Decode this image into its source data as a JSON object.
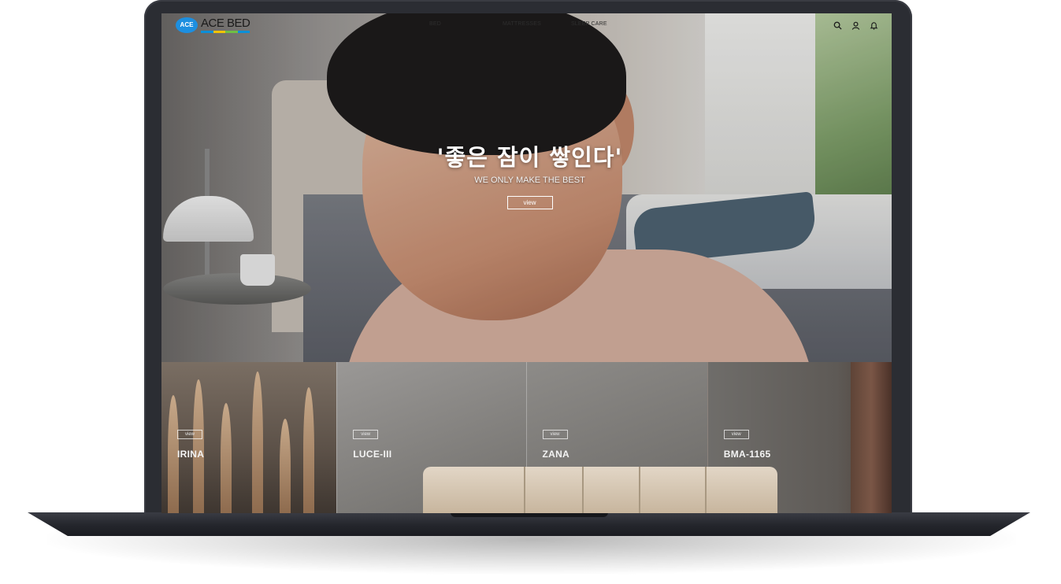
{
  "brand": {
    "badge": "ACE",
    "name": "ACE BED",
    "stripe_colors": [
      "#0b8fd8",
      "#f2c300",
      "#6fbe44",
      "#0b8fd8"
    ]
  },
  "nav": {
    "items": [
      "BED",
      "MATTRESSES",
      "SLEEP CARE"
    ]
  },
  "header_icons": [
    "search-icon",
    "user-icon",
    "bell-icon"
  ],
  "hero": {
    "title": "'좋은 잠이 쌓인다'",
    "subtitle": "WE ONLY MAKE THE BEST",
    "button_label": "view"
  },
  "products": [
    {
      "name": "IRINA",
      "button_label": "view"
    },
    {
      "name": "LUCE-III",
      "button_label": "view"
    },
    {
      "name": "ZANA",
      "button_label": "view"
    },
    {
      "name": "BMA-1165",
      "button_label": "view"
    }
  ],
  "colors": {
    "laptop_frame": "#2b2d33",
    "brand_blue": "#1d8fe0"
  }
}
